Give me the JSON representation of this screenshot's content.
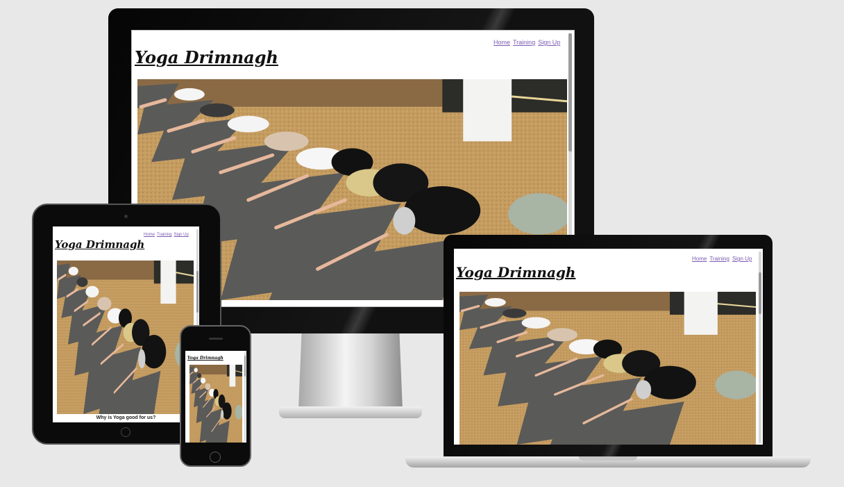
{
  "site": {
    "brand": "Yoga Drimnagh",
    "nav": [
      "Home",
      "Training",
      "Sign Up"
    ],
    "tablet_heading": "Why is Yoga good for us?"
  },
  "colors": {
    "background": "#e8e8e8",
    "link": "#7b5bb3",
    "bezel": "#0b0b0b",
    "floor": "#c29a5e",
    "mat": "#5c5c5c"
  },
  "devices": [
    "desktop-monitor",
    "laptop",
    "tablet",
    "phone"
  ]
}
